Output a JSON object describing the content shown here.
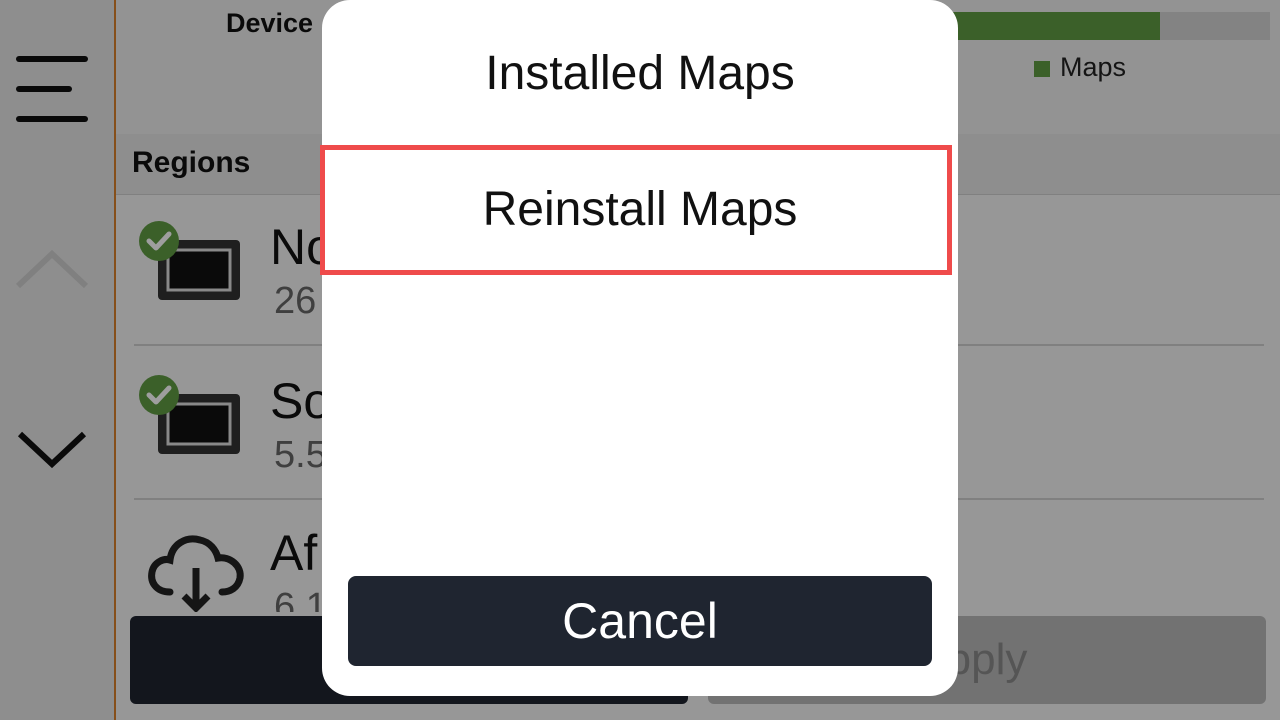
{
  "background": {
    "device_label": "Device",
    "storage_fraction_used": 0.66,
    "legend_maps": "Maps",
    "legend_other_partial": "e",
    "regions_title": "Regions",
    "regions": [
      {
        "name": "No",
        "size": "26",
        "installed": true
      },
      {
        "name": "So",
        "size": "5.5",
        "installed": true
      },
      {
        "name": "Af",
        "size": "6.1",
        "installed": false
      }
    ],
    "apply_button_partial": "pply"
  },
  "dialog": {
    "option_installed": "Installed Maps",
    "option_reinstall": "Reinstall Maps",
    "cancel_label": "Cancel"
  },
  "colors": {
    "accent_green": "#5f9b43",
    "highlight_red": "#ef4b4b",
    "dark_button": "#1f2530",
    "rail_border": "#d9802a"
  }
}
